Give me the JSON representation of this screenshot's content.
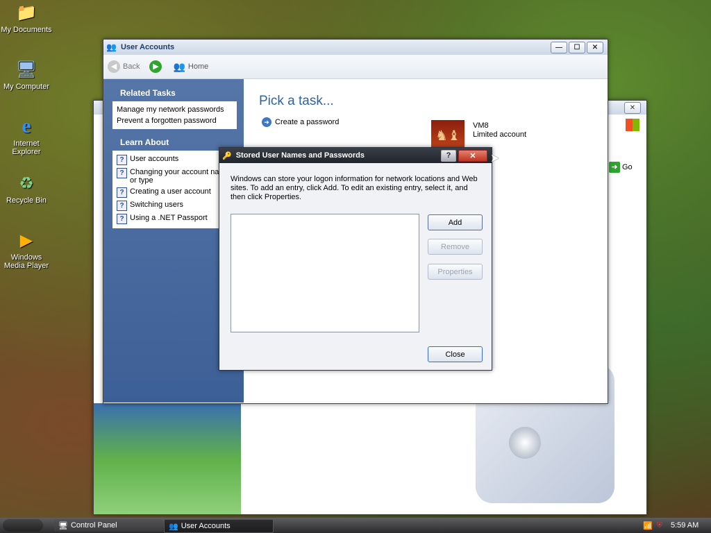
{
  "desktop": {
    "icons": [
      {
        "label": "My Documents",
        "icon": "folder-documents-icon"
      },
      {
        "label": "My Computer",
        "icon": "computer-icon"
      },
      {
        "label": "Internet Explorer",
        "icon": "internet-explorer-icon"
      },
      {
        "label": "Recycle Bin",
        "icon": "recycle-bin-icon"
      },
      {
        "label": "Windows Media Player",
        "icon": "media-player-icon"
      }
    ]
  },
  "back_window": {
    "go_label": "Go"
  },
  "user_accounts": {
    "title": "User Accounts",
    "nav": {
      "back": "Back",
      "home": "Home"
    },
    "related_tasks": {
      "heading": "Related Tasks",
      "items": [
        "Manage my network passwords",
        "Prevent a forgotten password"
      ]
    },
    "learn_about": {
      "heading": "Learn About",
      "items": [
        "User accounts",
        "Changing your account name or type",
        "Creating a user account",
        "Switching users",
        "Using a .NET Passport"
      ]
    },
    "pick_task": "Pick a task...",
    "tasks": [
      "Create a password"
    ],
    "account": {
      "name": "VM8",
      "type": "Limited account"
    }
  },
  "dialog": {
    "title": "Stored User Names and Passwords",
    "description": "Windows can store your logon information for network locations and Web sites. To add an entry, click Add. To edit an existing entry, select it, and then click Properties.",
    "buttons": {
      "add": "Add",
      "remove": "Remove",
      "properties": "Properties",
      "close": "Close"
    }
  },
  "taskbar": {
    "items": [
      "Control Panel",
      "User Accounts"
    ],
    "clock": "5:59 AM"
  }
}
